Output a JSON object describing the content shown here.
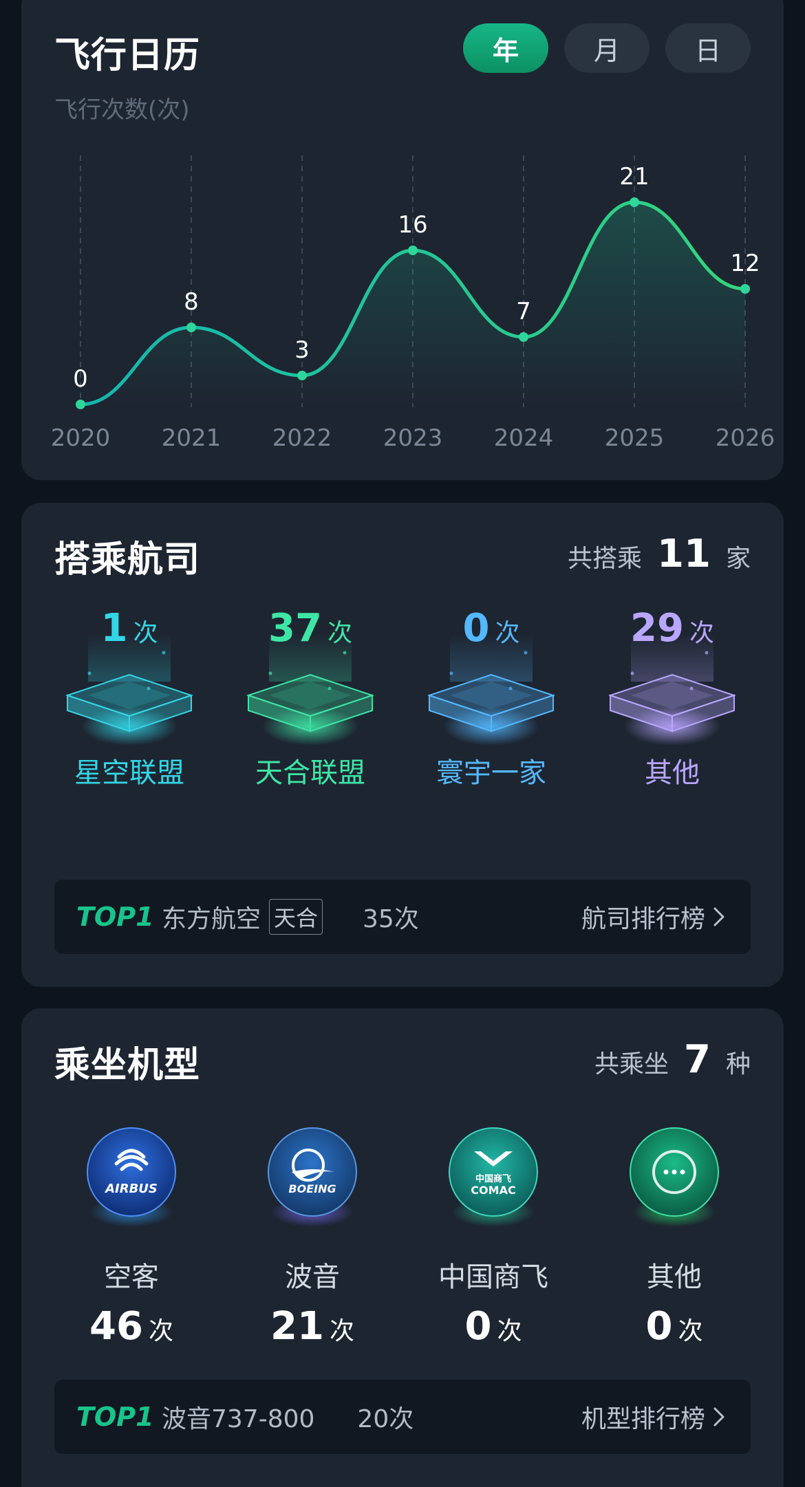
{
  "calendar": {
    "title": "飞行日历",
    "segments": [
      "年",
      "月",
      "日"
    ],
    "active_segment": "年",
    "y_axis_label": "飞行次数(次)"
  },
  "chart_data": {
    "type": "line",
    "x": [
      "2020",
      "2021",
      "2022",
      "2023",
      "2024",
      "2025",
      "2026"
    ],
    "series": [
      {
        "values": [
          0,
          8,
          3,
          16,
          7,
          21,
          12
        ]
      }
    ],
    "ylabel": "飞行次数(次)",
    "grid": "vertical dashed",
    "color": "#1fd39a"
  },
  "airlines": {
    "title": "搭乘航司",
    "total_prefix": "共搭乘",
    "total_value": "11",
    "total_suffix": "家",
    "alliances": [
      {
        "name": "星空联盟",
        "count": "1",
        "unit": "次",
        "color": "#34d6e6",
        "icon": "cyan-platform-icon"
      },
      {
        "name": "天合联盟",
        "count": "37",
        "unit": "次",
        "color": "#3ee6a6",
        "icon": "green-platform-icon"
      },
      {
        "name": "寰宇一家",
        "count": "0",
        "unit": "次",
        "color": "#54b8ff",
        "icon": "blue-platform-icon"
      },
      {
        "name": "其他",
        "count": "29",
        "unit": "次",
        "color": "#b9a6ff",
        "icon": "purple-platform-icon"
      }
    ],
    "top": {
      "badge": "TOP1",
      "name": "东方航空",
      "tag": "天合",
      "count": "35次",
      "link": "航司排行榜"
    }
  },
  "aircraft": {
    "title": "乘坐机型",
    "total_prefix": "共乘坐",
    "total_value": "7",
    "total_suffix": "种",
    "makers": [
      {
        "name": "空客",
        "count": "46",
        "unit": "次",
        "logo_text": "AIRBUS",
        "icon": "airbus-logo-icon"
      },
      {
        "name": "波音",
        "count": "21",
        "unit": "次",
        "logo_text": "BOEING",
        "icon": "boeing-logo-icon"
      },
      {
        "name": "中国商飞",
        "count": "0",
        "unit": "次",
        "logo_text": "中国商飞 COMAC",
        "icon": "comac-logo-icon"
      },
      {
        "name": "其他",
        "count": "0",
        "unit": "次",
        "logo_text": "",
        "icon": "more-icon"
      }
    ],
    "top": {
      "badge": "TOP1",
      "name": "波音737-800",
      "count": "20次",
      "link": "机型排行榜"
    }
  }
}
